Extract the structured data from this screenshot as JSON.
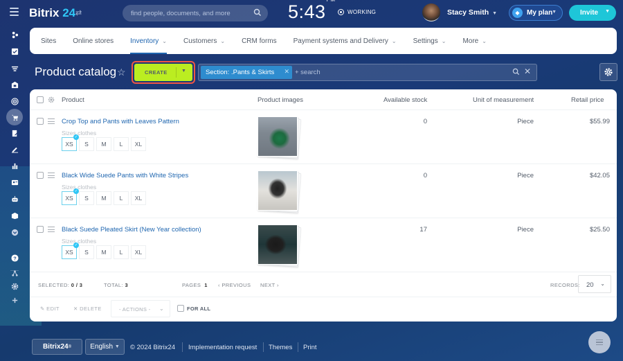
{
  "header": {
    "logo_main": "Bitrix",
    "logo_num": "24",
    "search_placeholder": "find people, documents, and more",
    "time": "5:43",
    "time_suffix": "PM",
    "work_status": "WORKING",
    "user_name": "Stacy Smith",
    "plan_label": "My plan",
    "invite_label": "Invite"
  },
  "left_nav": {
    "items": [
      "sites-icon",
      "tasks-icon",
      "crm-funnel-icon",
      "bank-icon",
      "target-icon",
      "shop-cart-icon",
      "document-edit-icon",
      "signature-icon",
      "analytics-icon",
      "contact-card-icon",
      "robot-icon",
      "box-icon",
      "more-down-icon",
      "help-icon",
      "structure-icon",
      "settings-icon",
      "add-icon"
    ],
    "active": "shop-cart-icon"
  },
  "tabs": [
    {
      "label": "Sites",
      "dropdown": false
    },
    {
      "label": "Online stores",
      "dropdown": false
    },
    {
      "label": "Inventory",
      "dropdown": true,
      "active": true
    },
    {
      "label": "Customers",
      "dropdown": true
    },
    {
      "label": "CRM forms",
      "dropdown": false
    },
    {
      "label": "Payment systems and Delivery",
      "dropdown": true
    },
    {
      "label": "Settings",
      "dropdown": true
    },
    {
      "label": "More",
      "dropdown": true
    }
  ],
  "page": {
    "title": "Product catalog",
    "create_label": "CREATE",
    "filter_chip": "Section: .Pants & Skirts",
    "filter_placeholder": "+ search"
  },
  "grid": {
    "columns": [
      "Product",
      "Product images",
      "Available stock",
      "Unit of measurement",
      "Retail price"
    ],
    "rows": [
      {
        "name": "Crop Top and Pants with Leaves Pattern",
        "property": "Sizes clothes",
        "sizes": [
          "XS",
          "S",
          "M",
          "L",
          "XL"
        ],
        "selected_size": "XS",
        "stock": "0",
        "unit": "Piece",
        "price": "$55.99"
      },
      {
        "name": "Black Wide Suede Pants with White Stripes",
        "property": "Sizes clothes",
        "sizes": [
          "XS",
          "S",
          "M",
          "L",
          "XL"
        ],
        "selected_size": "XS",
        "stock": "0",
        "unit": "Piece",
        "price": "$42.05"
      },
      {
        "name": "Black Suede Pleated Skirt (New Year collection)",
        "property": "Sizes clothes",
        "sizes": [
          "XS",
          "S",
          "M",
          "L",
          "XL"
        ],
        "selected_size": "XS",
        "stock": "17",
        "unit": "Piece",
        "price": "$25.50"
      }
    ],
    "footer": {
      "selected_label": "SELECTED:",
      "selected_value": "0 / 3",
      "total_label": "TOTAL:",
      "total_value": "3",
      "pages_label": "PAGES",
      "pages_value": "1",
      "previous": "PREVIOUS",
      "next": "NEXT",
      "records_label": "RECORDS:",
      "records_value": "20"
    },
    "actions": {
      "edit": "EDIT",
      "delete": "DELETE",
      "actions_select": "- ACTIONS -",
      "for_all": "FOR ALL"
    }
  },
  "footer": {
    "brand": "Bitrix24",
    "language": "English",
    "copyright": "© 2024 Bitrix24",
    "links": [
      "Implementation request",
      "Themes",
      "Print"
    ]
  },
  "colors": {
    "accent": "#2067b0",
    "create": "#bbed21",
    "invite": "#1ec6d8",
    "filter_chip": "#2e8ccf",
    "highlight": "#f05545"
  }
}
